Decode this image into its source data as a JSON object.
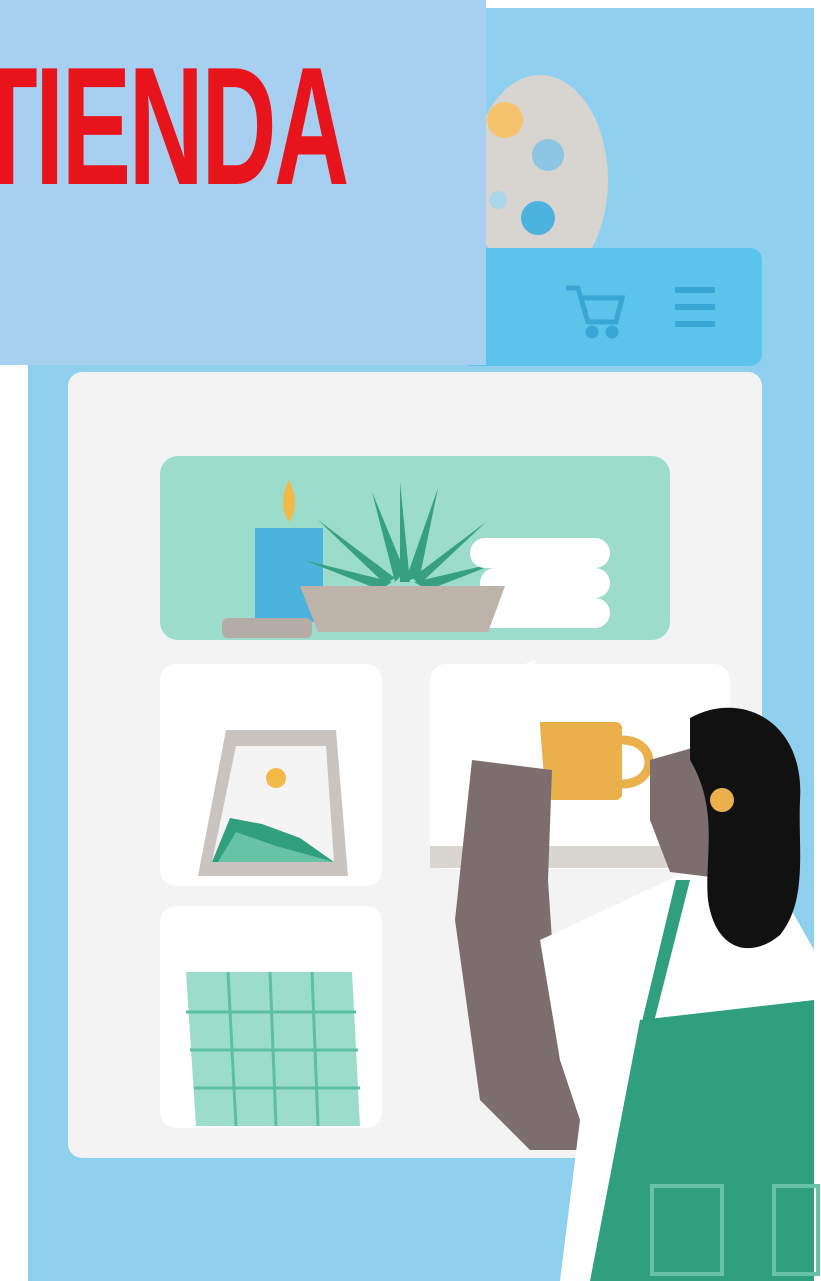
{
  "banner": {
    "title": "TIENDA"
  },
  "colors": {
    "title_text": "#e8141c",
    "banner_bg": "#a7cff0",
    "screen_bg": "#8fd0ef",
    "header_bar": "#5cc4ea",
    "panel_bg": "#f3f3f3",
    "shelf_teal": "#9cdccb",
    "apron_green": "#2f9f7e",
    "skin": "#7c6e6e",
    "hair": "#111111",
    "jug_yellow": "#eab04b"
  },
  "icons": {
    "header": [
      "cart-icon",
      "menu-icon"
    ]
  }
}
